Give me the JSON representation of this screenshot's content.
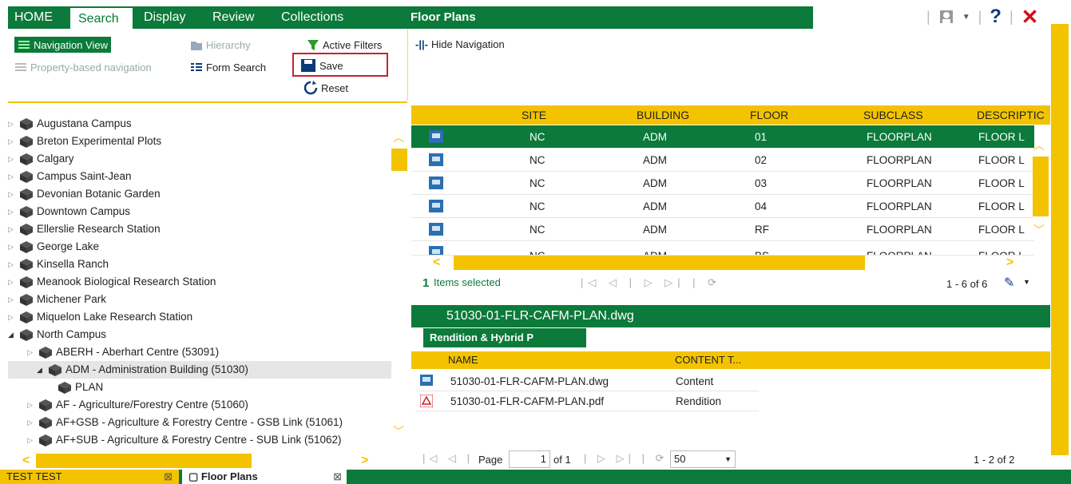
{
  "nav": {
    "home": "HOME",
    "search": "Search",
    "display": "Display",
    "review": "Review",
    "collections": "Collections",
    "panel_title": "Floor Plans"
  },
  "ribbon": {
    "navigation_view": "Navigation View",
    "hierarchy": "Hierarchy",
    "active_filters": "Active Filters",
    "property_nav": "Property-based navigation",
    "form_search": "Form Search",
    "save": "Save",
    "reset": "Reset",
    "hide_navigation": "Hide Navigation"
  },
  "tree": {
    "items": [
      {
        "label": "Augustana Campus"
      },
      {
        "label": "Breton Experimental Plots"
      },
      {
        "label": "Calgary"
      },
      {
        "label": "Campus Saint-Jean"
      },
      {
        "label": "Devonian Botanic Garden"
      },
      {
        "label": "Downtown Campus"
      },
      {
        "label": "Ellerslie Research Station"
      },
      {
        "label": "George Lake"
      },
      {
        "label": "Kinsella Ranch"
      },
      {
        "label": "Meanook Biological Research Station"
      },
      {
        "label": "Michener Park"
      },
      {
        "label": "Miquelon Lake Research Station"
      },
      {
        "label": "North Campus"
      },
      {
        "label": "ABERH - Aberhart Centre (53091)"
      },
      {
        "label": "ADM - Administration Building (51030)"
      },
      {
        "label": "PLAN"
      },
      {
        "label": "AF - Agriculture/Forestry Centre (51060)"
      },
      {
        "label": "AF+GSB - Agriculture & Forestry Centre - GSB Link (51061)"
      },
      {
        "label": "AF+SUB - Agriculture & Forestry Centre - SUB Link (51062)"
      }
    ]
  },
  "grid": {
    "columns": [
      "SITE",
      "BUILDING",
      "FLOOR",
      "SUBCLASS",
      "DESCRIPTIC"
    ],
    "rows": [
      {
        "site": "NC",
        "building": "ADM",
        "floor": "01",
        "subclass": "FLOORPLAN",
        "desc": "FLOOR L"
      },
      {
        "site": "NC",
        "building": "ADM",
        "floor": "02",
        "subclass": "FLOORPLAN",
        "desc": "FLOOR L"
      },
      {
        "site": "NC",
        "building": "ADM",
        "floor": "03",
        "subclass": "FLOORPLAN",
        "desc": "FLOOR L"
      },
      {
        "site": "NC",
        "building": "ADM",
        "floor": "04",
        "subclass": "FLOORPLAN",
        "desc": "FLOOR L"
      },
      {
        "site": "NC",
        "building": "ADM",
        "floor": "RF",
        "subclass": "FLOORPLAN",
        "desc": "FLOOR L"
      },
      {
        "site": "NC",
        "building": "ADM",
        "floor": "BS",
        "subclass": "FLOORPLAN",
        "desc": "FLOOR L"
      }
    ],
    "selected_count": "1",
    "items_selected": "Items selected",
    "range": "1 - 6 of 6"
  },
  "detail": {
    "title": "51030-01-FLR-CAFM-PLAN.dwg",
    "tab": "Rendition & Hybrid P",
    "col_name": "NAME",
    "col_content": "CONTENT T...",
    "rows": [
      {
        "name": "51030-01-FLR-CAFM-PLAN.dwg",
        "type": "Content"
      },
      {
        "name": "51030-01-FLR-CAFM-PLAN.pdf",
        "type": "Rendition"
      }
    ]
  },
  "pager": {
    "page_label": "Page",
    "page_value": "1",
    "of": "of 1",
    "page_size": "50",
    "range": "1 - 2 of 2"
  },
  "bottom_tabs": {
    "tab1": "TEST TEST",
    "tab2": "Floor Plans"
  },
  "colors": {
    "green": "#0b7a3a",
    "yellow": "#f3c300",
    "red": "#c8222a"
  }
}
